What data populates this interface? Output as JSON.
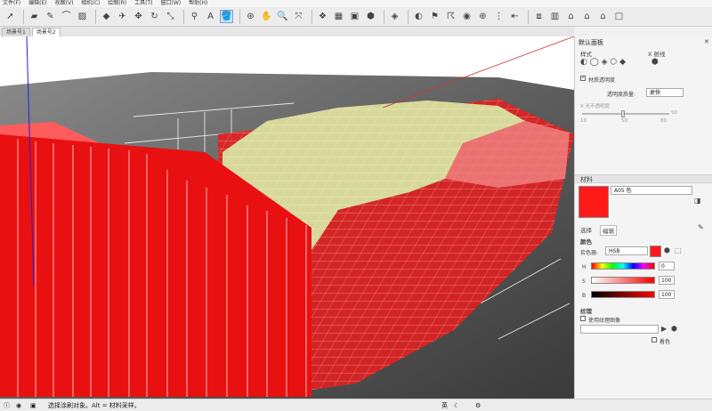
{
  "menu": [
    "文件(F)",
    "编辑(E)",
    "视图(V)",
    "相机(C)",
    "绘图(R)",
    "工具(T)",
    "窗口(W)",
    "帮助(H)"
  ],
  "scene_tabs": [
    "场景号1",
    "场景号2"
  ],
  "panel": {
    "title": "默认面板",
    "styles_label": "样式",
    "xray_label": "X 射线",
    "transparency_checkbox": "材质透明度",
    "quality_label": "透明度质量:",
    "quality_value": "更快",
    "opacity_label": "X 光不透明度",
    "opacity_value": "50",
    "ticks": [
      "10",
      "50",
      "80"
    ],
    "materials_title": "材料",
    "material_name": "A05 色",
    "tab_select": "选择",
    "tab_edit": "编辑",
    "color_label": "颜色",
    "picker_label": "拾色器:",
    "picker_value": "HSB",
    "h_label": "H",
    "h_value": "0",
    "s_label": "S",
    "s_value": "100",
    "b_label": "B",
    "b_value": "100",
    "texture_label": "纹理",
    "use_texture": "使用纹理图像",
    "colorize_label": "着色"
  },
  "status": {
    "message": "选择涂刷对象。Alt = 材料采样。",
    "ime": "英"
  },
  "colors": {
    "material": "#ff1a1a",
    "terrain": "#4a4a4a",
    "field": "#d8d89a"
  }
}
